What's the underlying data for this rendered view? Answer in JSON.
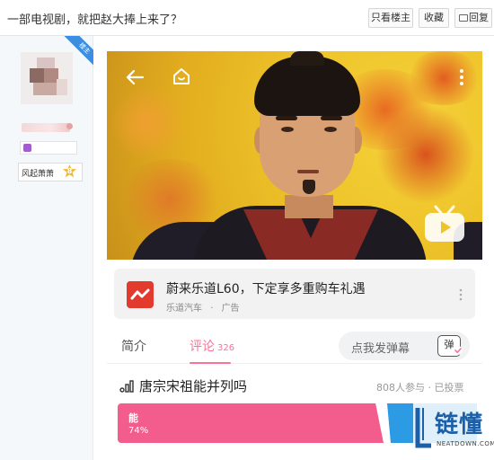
{
  "thread": {
    "title": "一部电视剧，就把赵大捧上来了？",
    "buttons": {
      "only_op": "只看楼主",
      "collect": "收藏",
      "reply": "回复"
    }
  },
  "user": {
    "badge": "楼主",
    "level_name": "风起萧萧",
    "level": "8"
  },
  "video": {
    "icons": [
      "back-arrow-icon",
      "home-icon",
      "more-icon",
      "tv-icon"
    ]
  },
  "ad": {
    "title": "蔚来乐道L60，下定享多重购车礼遇",
    "advertiser": "乐道汽车",
    "separator": "·",
    "tag": "广告"
  },
  "tabs": {
    "intro": "简介",
    "comments": "评论",
    "comment_count": "326",
    "danmaku_placeholder": "点我发弹幕",
    "danmaku_icon_label": "弹"
  },
  "poll": {
    "title": "唐宗宋祖能并列吗",
    "meta": "808人参与 · 已投票",
    "option_label": "能",
    "option_percent_text": "74%",
    "option_share": 0.74
  },
  "watermark": {
    "name": "链懂",
    "site": "NEATDOWN.COM"
  },
  "colors": {
    "accent_pink": "#fb7299",
    "poll_pink": "#f25d8e",
    "poll_blue": "#2d9be4",
    "ad_logo_red": "#e23b2e",
    "video_yellow": "#eec42a"
  }
}
